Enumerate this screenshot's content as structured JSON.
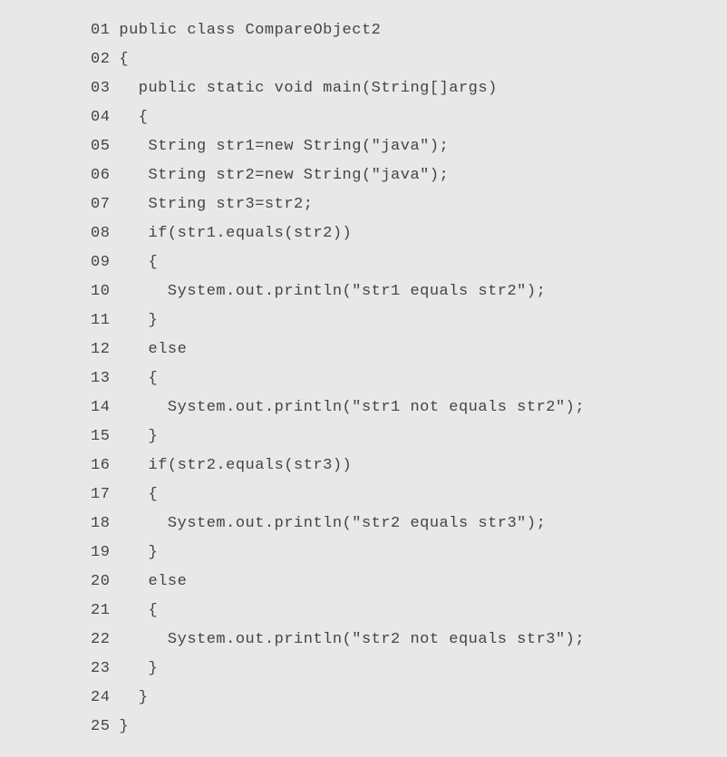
{
  "code": {
    "lines": [
      {
        "num": "01",
        "text": "public class CompareObject2"
      },
      {
        "num": "02",
        "text": "{"
      },
      {
        "num": "03",
        "text": "  public static void main(String[]args)"
      },
      {
        "num": "04",
        "text": "  {"
      },
      {
        "num": "05",
        "text": "   String str1=new String(\"java\");"
      },
      {
        "num": "06",
        "text": "   String str2=new String(\"java\");"
      },
      {
        "num": "07",
        "text": "   String str3=str2;"
      },
      {
        "num": "08",
        "text": "   if(str1.equals(str2))"
      },
      {
        "num": "09",
        "text": "   {"
      },
      {
        "num": "10",
        "text": "     System.out.println(\"str1 equals str2\");"
      },
      {
        "num": "11",
        "text": "   }"
      },
      {
        "num": "12",
        "text": "   else"
      },
      {
        "num": "13",
        "text": "   {"
      },
      {
        "num": "14",
        "text": "     System.out.println(\"str1 not equals str2\");"
      },
      {
        "num": "15",
        "text": "   }"
      },
      {
        "num": "16",
        "text": "   if(str2.equals(str3))"
      },
      {
        "num": "17",
        "text": "   {"
      },
      {
        "num": "18",
        "text": "     System.out.println(\"str2 equals str3\");"
      },
      {
        "num": "19",
        "text": "   }"
      },
      {
        "num": "20",
        "text": "   else"
      },
      {
        "num": "21",
        "text": "   {"
      },
      {
        "num": "22",
        "text": "     System.out.println(\"str2 not equals str3\");"
      },
      {
        "num": "23",
        "text": "   }"
      },
      {
        "num": "24",
        "text": "  }"
      },
      {
        "num": "25",
        "text": "}"
      }
    ]
  }
}
